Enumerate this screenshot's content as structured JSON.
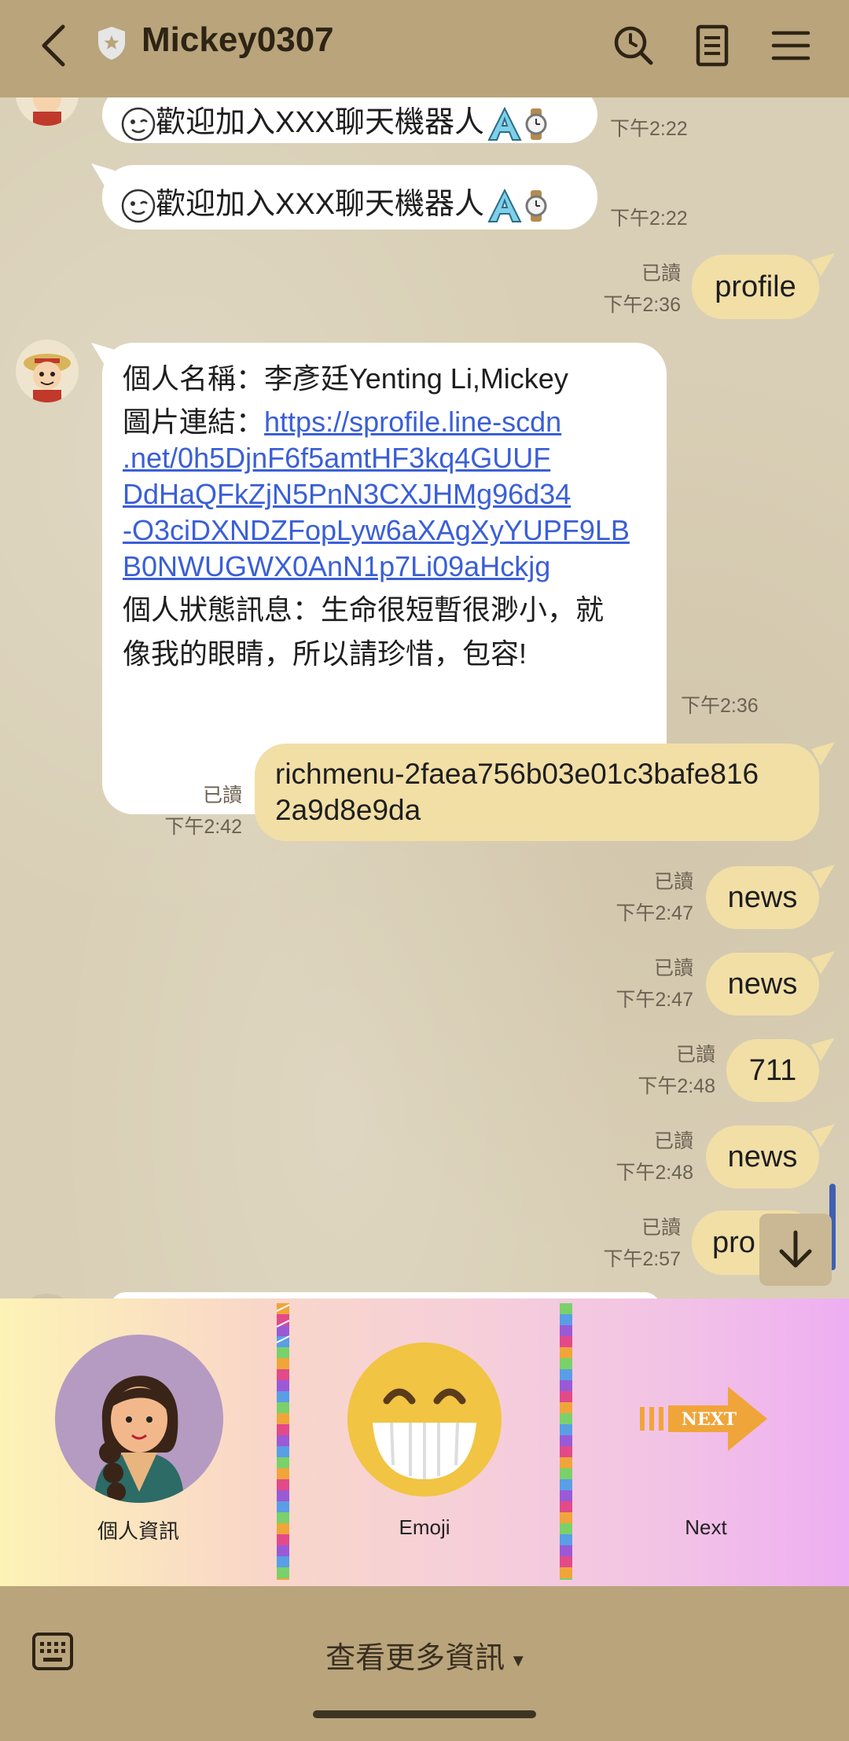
{
  "header": {
    "title": "Mickey0307",
    "icons": [
      "back-arrow-icon",
      "shield-star-icon",
      "search-icon",
      "notes-icon",
      "menu-icon"
    ],
    "bg_color": "#b9a47c"
  },
  "messages": {
    "welcome1": {
      "text": "歡迎加入XXX聊天機器人",
      "time": "下午2:22"
    },
    "welcome2": {
      "text": "歡迎加入XXX聊天機器人",
      "time": "下午2:22"
    },
    "out_profile": {
      "text": "profile",
      "read": "已讀",
      "time": "下午2:36"
    },
    "profile_reply": {
      "name_line": "個人名稱：李彥廷Yenting Li,Mickey",
      "pic_label": "圖片連結：",
      "pic_link_1": "https://sprofile.line-scdn",
      "pic_link_2": ".net/0h5DjnF6f5amtHF3kq4GUUF",
      "pic_link_3": "DdHaQFkZjN5PnN3CXJHMg96d34",
      "pic_link_4": "-O3ciDXNDZFopLyw6aXAgXyYUPF9LB",
      "pic_link_5": "B0NWUGWX0AnN1p7Li09aHckjg",
      "status_line_1": "個人狀態訊息：生命很短暫很渺小，就",
      "status_line_2": "像我的眼睛，所以請珍惜，包容!",
      "time": "下午2:36"
    },
    "out_richmenu": {
      "line1": "richmenu-2faea756b03e01c3bafe816",
      "line2": "2a9d8e9da",
      "read": "已讀",
      "time": "下午2:42"
    },
    "out_news1": {
      "text": "news",
      "read": "已讀",
      "time": "下午2:47"
    },
    "out_news2": {
      "text": "news",
      "read": "已讀",
      "time": "下午2:47"
    },
    "out_711": {
      "text": "711",
      "read": "已讀",
      "time": "下午2:48"
    },
    "out_news3": {
      "text": "news",
      "read": "已讀",
      "time": "下午2:48"
    },
    "out_pro": {
      "text": "pro",
      "read": "已讀",
      "time": "下午2:57"
    }
  },
  "richmenu": {
    "items": [
      {
        "label": "個人資訊",
        "icon": "person-avatar-icon"
      },
      {
        "label": "Emoji",
        "icon": "grin-face-icon"
      },
      {
        "label": "Next",
        "icon": "next-arrow-icon",
        "arrow_text": "NEXT"
      }
    ]
  },
  "bottombar": {
    "more_label": "查看更多資訊",
    "caret": "▾",
    "icon": "keyboard-icon"
  },
  "colors": {
    "incoming_bubble": "#ffffff",
    "outgoing_bubble": "#f2dfa6",
    "link": "#3a5fd6",
    "chat_bg": "#d9cfb6"
  }
}
